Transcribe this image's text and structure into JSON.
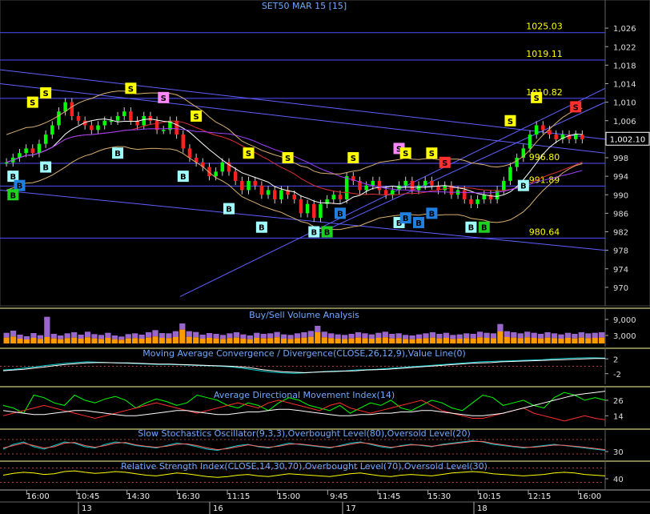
{
  "chart_data": [
    {
      "type": "candlestick",
      "title": "SET50 MAR 15   [15]",
      "ylim": [
        966,
        1030
      ],
      "y_ticks": [
        "1,026",
        "1,022",
        "1,018",
        "1,014",
        "1,010",
        "1,006",
        "1,002",
        "998",
        "994",
        "990",
        "986",
        "982",
        "978",
        "974",
        "970"
      ],
      "y_tick_values": [
        1026,
        1022,
        1018,
        1014,
        1010,
        1006,
        1002,
        998,
        994,
        990,
        986,
        982,
        978,
        974,
        970
      ],
      "last_price": "1,002.10",
      "last_price_value": 1002.1,
      "price_levels": [
        {
          "label": "1025.03",
          "value": 1025.03
        },
        {
          "label": "1019.11",
          "value": 1019.11
        },
        {
          "label": "1010.82",
          "value": 1010.82
        },
        {
          "label": "996.80",
          "value": 996.8
        },
        {
          "label": "991.89",
          "value": 991.89
        },
        {
          "label": "980.64",
          "value": 980.64
        }
      ],
      "candles_close": [
        997,
        998,
        999,
        1000,
        999,
        1001,
        1003,
        1005,
        1008,
        1010,
        1007,
        1006,
        1005,
        1004,
        1005,
        1006,
        1006,
        1007,
        1008,
        1006,
        1005,
        1007,
        1006,
        1004,
        1004,
        1006,
        1003,
        1000,
        998,
        997,
        996,
        994,
        995,
        997,
        995,
        993,
        991,
        993,
        992,
        990,
        991,
        989,
        991,
        990,
        989,
        986,
        988,
        985,
        988,
        989,
        990,
        989,
        994,
        993,
        991,
        992,
        993,
        991,
        990,
        991,
        992,
        993,
        991,
        992,
        993,
        992,
        991,
        992,
        990,
        991,
        989,
        988,
        989,
        990,
        989,
        991,
        993,
        996,
        998,
        1000,
        1003,
        1005,
        1004,
        1003,
        1002,
        1003,
        1002,
        1003,
        1002
      ],
      "signals": [
        {
          "type": "S",
          "style": "yellow",
          "index": 4,
          "price": 1010
        },
        {
          "type": "S",
          "style": "yellow",
          "index": 6,
          "price": 1012
        },
        {
          "type": "S",
          "style": "yellow",
          "index": 19,
          "price": 1013
        },
        {
          "type": "S",
          "style": "pink",
          "index": 24,
          "price": 1011
        },
        {
          "type": "S",
          "style": "yellow",
          "index": 29,
          "price": 1007
        },
        {
          "type": "S",
          "style": "yellow",
          "index": 37,
          "price": 999
        },
        {
          "type": "S",
          "style": "yellow",
          "index": 43,
          "price": 998
        },
        {
          "type": "S",
          "style": "yellow",
          "index": 53,
          "price": 998
        },
        {
          "type": "S",
          "style": "pink",
          "index": 60,
          "price": 1000
        },
        {
          "type": "S",
          "style": "yellow",
          "index": 61,
          "price": 999
        },
        {
          "type": "S",
          "style": "yellow",
          "index": 65,
          "price": 999
        },
        {
          "type": "S",
          "style": "red",
          "index": 67,
          "price": 997
        },
        {
          "type": "S",
          "style": "yellow",
          "index": 77,
          "price": 1006
        },
        {
          "type": "S",
          "style": "yellow",
          "index": 81,
          "price": 1011
        },
        {
          "type": "S",
          "style": "red",
          "index": 87,
          "price": 1009
        },
        {
          "type": "B",
          "style": "cyan",
          "index": 1,
          "price": 994
        },
        {
          "type": "B",
          "style": "blue",
          "index": 2,
          "price": 992
        },
        {
          "type": "B",
          "style": "green",
          "index": 1,
          "price": 990
        },
        {
          "type": "B",
          "style": "cyan",
          "index": 6,
          "price": 996
        },
        {
          "type": "B",
          "style": "cyan",
          "index": 17,
          "price": 999
        },
        {
          "type": "B",
          "style": "cyan",
          "index": 27,
          "price": 994
        },
        {
          "type": "B",
          "style": "cyan",
          "index": 34,
          "price": 987
        },
        {
          "type": "B",
          "style": "cyan",
          "index": 39,
          "price": 983
        },
        {
          "type": "B",
          "style": "cyan",
          "index": 47,
          "price": 982
        },
        {
          "type": "B",
          "style": "green",
          "index": 49,
          "price": 982
        },
        {
          "type": "B",
          "style": "blue",
          "index": 51,
          "price": 986
        },
        {
          "type": "B",
          "style": "cyan",
          "index": 60,
          "price": 984
        },
        {
          "type": "B",
          "style": "blue",
          "index": 61,
          "price": 985
        },
        {
          "type": "B",
          "style": "blue",
          "index": 63,
          "price": 984
        },
        {
          "type": "B",
          "style": "blue",
          "index": 65,
          "price": 986
        },
        {
          "type": "B",
          "style": "cyan",
          "index": 71,
          "price": 983
        },
        {
          "type": "B",
          "style": "green",
          "index": 73,
          "price": 983
        },
        {
          "type": "B",
          "style": "cyan",
          "index": 79,
          "price": 992
        }
      ],
      "colors": {
        "up": "#00ff00",
        "down": "#ff2020",
        "background": "#000000",
        "grid": "#4040ff",
        "level_text": "#ffff00"
      }
    },
    {
      "type": "bar",
      "title": "Buy/Sell Volume Analysis",
      "y_ticks": [
        "9,000",
        "3,000"
      ],
      "y_tick_values": [
        9000,
        3000
      ],
      "ylim": [
        0,
        12000
      ],
      "buy_values": [
        2200,
        2600,
        1800,
        1500,
        2100,
        1700,
        2400,
        1900,
        1600,
        2000,
        2200,
        1800,
        2300,
        1900,
        1700,
        2100,
        1600,
        1400,
        1900,
        2000,
        1800,
        2200,
        2600,
        2100,
        2000,
        2400,
        5200,
        2500,
        2300,
        1800,
        2100,
        1900,
        1700,
        2000,
        2200,
        1800,
        1600,
        2100,
        1900,
        2000,
        2300,
        1800,
        1700,
        2000,
        2200,
        2500,
        4200,
        2300,
        2000,
        1800,
        1700,
        1900,
        2200,
        2000,
        1800,
        2100,
        2300,
        1900,
        2000,
        1700,
        1600,
        1800,
        2000,
        2200,
        1900,
        2100,
        1700,
        1800,
        2000,
        1900,
        2300,
        2100,
        2000,
        4500,
        2400,
        2200,
        2000,
        2300,
        2100,
        1900,
        2200,
        2000,
        1800,
        2100,
        1900,
        2200,
        2000,
        2100,
        2200
      ],
      "sell_values": [
        1800,
        2200,
        1500,
        1200,
        1800,
        1400,
        7600,
        1700,
        1400,
        1800,
        2000,
        1500,
        2100,
        1600,
        1500,
        1900,
        1400,
        1200,
        1600,
        1800,
        1500,
        2000,
        2400,
        1800,
        1800,
        2200,
        2300,
        2100,
        2000,
        1500,
        1800,
        1700,
        1500,
        1800,
        2000,
        1600,
        1400,
        1900,
        1700,
        1800,
        2000,
        1600,
        1500,
        1800,
        2000,
        2200,
        2400,
        2100,
        1800,
        1600,
        1500,
        1700,
        2000,
        1800,
        1600,
        1900,
        2100,
        1700,
        1800,
        1500,
        1400,
        1600,
        1800,
        2000,
        1700,
        1900,
        1500,
        1600,
        1800,
        1700,
        2100,
        1900,
        1800,
        2800,
        2200,
        2000,
        1800,
        2100,
        1900,
        1700,
        2000,
        1800,
        1600,
        1900,
        1700,
        2000,
        1800,
        1900,
        2000
      ],
      "colors": {
        "buy": "#ff9900",
        "sell": "#9966cc"
      }
    },
    {
      "type": "line",
      "title": "Moving Average Convergence / Divergence(CLOSE,26,12,9),Value Line(0)",
      "y_ticks": [
        "2",
        "-2"
      ],
      "y_tick_values": [
        2,
        -2
      ],
      "ylim": [
        -4,
        4
      ],
      "series": [
        {
          "values": [
            -1,
            -0.8,
            -0.5,
            -0.2,
            0.2,
            0.5,
            0.8,
            1,
            1.2,
            1.1,
            1,
            0.9,
            0.8,
            0.7,
            0.6,
            0.5,
            0.5,
            0.4,
            0.3,
            0.2,
            0.1,
            0,
            -0.2,
            -0.5,
            -0.9,
            -1.3,
            -1.6,
            -1.8,
            -1.9,
            -1.8,
            -1.6,
            -1.4,
            -1.3,
            -1.2,
            -1.0,
            -0.9,
            -0.8,
            -0.6,
            -0.4,
            -0.2,
            0,
            0.2,
            0.4,
            0.6,
            0.8,
            1,
            1.2,
            1.3,
            1.4,
            1.5,
            1.6,
            1.7,
            1.8,
            2,
            2.1,
            2.2,
            2.3,
            2.3,
            2.2
          ],
          "color": "#00cccc"
        },
        {
          "values": [
            -1.2,
            -1,
            -0.8,
            -0.5,
            -0.2,
            0.2,
            0.5,
            0.7,
            0.9,
            1,
            1,
            0.9,
            0.9,
            0.8,
            0.7,
            0.6,
            0.6,
            0.5,
            0.4,
            0.3,
            0.2,
            0.1,
            0,
            -0.2,
            -0.5,
            -0.9,
            -1.2,
            -1.5,
            -1.6,
            -1.7,
            -1.6,
            -1.5,
            -1.4,
            -1.3,
            -1.2,
            -1.0,
            -0.9,
            -0.8,
            -0.6,
            -0.4,
            -0.2,
            0,
            0.2,
            0.4,
            0.6,
            0.8,
            0.9,
            1.0,
            1.2,
            1.3,
            1.4,
            1.5,
            1.6,
            1.7,
            1.8,
            1.9,
            2,
            2.1,
            2.1
          ],
          "color": "#ffffff"
        }
      ]
    },
    {
      "type": "line",
      "title": "Average Directional Movement Index(14)",
      "y_ticks": [
        "26",
        "14"
      ],
      "y_tick_values": [
        26,
        14
      ],
      "ylim": [
        8,
        34
      ],
      "series": [
        {
          "values": [
            22,
            20,
            16,
            30,
            28,
            24,
            22,
            30,
            26,
            24,
            27,
            29,
            26,
            20,
            24,
            27,
            25,
            22,
            24,
            30,
            28,
            26,
            22,
            20,
            24,
            22,
            18,
            24,
            28,
            26,
            22,
            20,
            18,
            22,
            16,
            20,
            24,
            22,
            26,
            20,
            18,
            22,
            26,
            24,
            20,
            18,
            24,
            30,
            28,
            22,
            24,
            26,
            22,
            20,
            28,
            32,
            30,
            26,
            28,
            26
          ],
          "color": "#00ff00"
        },
        {
          "values": [
            14,
            16,
            18,
            20,
            22,
            20,
            18,
            16,
            14,
            12,
            14,
            16,
            18,
            20,
            22,
            24,
            22,
            20,
            18,
            16,
            18,
            20,
            22,
            24,
            22,
            20,
            24,
            26,
            24,
            22,
            20,
            18,
            22,
            24,
            20,
            18,
            16,
            18,
            20,
            22,
            24,
            26,
            22,
            18,
            16,
            14,
            12,
            12,
            14,
            16,
            18,
            20,
            16,
            14,
            12,
            10,
            12,
            14,
            12,
            11
          ],
          "color": "#ff3030"
        },
        {
          "values": [
            18,
            17,
            16,
            15,
            15,
            16,
            17,
            18,
            18,
            17,
            16,
            15,
            14,
            14,
            15,
            16,
            17,
            18,
            18,
            17,
            16,
            15,
            15,
            16,
            17,
            17,
            18,
            19,
            19,
            18,
            17,
            16,
            15,
            14,
            14,
            15,
            15,
            16,
            16,
            17,
            17,
            18,
            18,
            17,
            16,
            15,
            14,
            14,
            15,
            16,
            18,
            20,
            22,
            24,
            26,
            28,
            30,
            31,
            32,
            33
          ],
          "color": "#ffffff"
        }
      ]
    },
    {
      "type": "line",
      "title": "Slow Stochastics Oscillator(9,3,3),Overbought Level(80),Oversold Level(20)",
      "y_ticks": [
        "30"
      ],
      "y_tick_values": [
        30
      ],
      "ylim": [
        10,
        110
      ],
      "series": [
        {
          "values": [
            40,
            60,
            70,
            50,
            40,
            55,
            70,
            65,
            50,
            45,
            60,
            70,
            65,
            55,
            50,
            45,
            55,
            65,
            60,
            50,
            40,
            35,
            45,
            55,
            60,
            50,
            45,
            55,
            65,
            60,
            55,
            50,
            45,
            55,
            65,
            70,
            60,
            50,
            45,
            55,
            60,
            55,
            50,
            60,
            65,
            70,
            75,
            70,
            60,
            55,
            50,
            45,
            50,
            55,
            60,
            55,
            50,
            45,
            40,
            35
          ],
          "color": "#00cccc"
        },
        {
          "values": [
            45,
            55,
            65,
            55,
            45,
            50,
            65,
            68,
            55,
            48,
            55,
            65,
            68,
            58,
            52,
            48,
            52,
            60,
            62,
            55,
            45,
            38,
            42,
            50,
            58,
            52,
            48,
            52,
            60,
            62,
            57,
            52,
            48,
            52,
            60,
            67,
            63,
            54,
            48,
            52,
            58,
            57,
            52,
            57,
            62,
            67,
            72,
            72,
            64,
            58,
            52,
            48,
            48,
            52,
            57,
            56,
            52,
            48,
            43,
            38
          ],
          "color": "#ff6060"
        }
      ]
    },
    {
      "type": "line",
      "title": "Relative Strength Index(CLOSE,14,30,70),Overbought Level(70),Oversold Level(30)",
      "y_ticks": [
        "40"
      ],
      "y_tick_values": [
        40
      ],
      "ylim": [
        20,
        80
      ],
      "series": [
        {
          "values": [
            50,
            55,
            58,
            56,
            52,
            54,
            60,
            62,
            58,
            55,
            57,
            60,
            58,
            54,
            50,
            48,
            52,
            56,
            54,
            50,
            46,
            44,
            46,
            50,
            52,
            48,
            46,
            50,
            54,
            52,
            50,
            48,
            46,
            50,
            54,
            56,
            52,
            48,
            46,
            50,
            52,
            50,
            48,
            52,
            56,
            58,
            60,
            58,
            54,
            52,
            50,
            48,
            50,
            52,
            56,
            58,
            56,
            52,
            50,
            48
          ],
          "color": "#ffff00"
        }
      ]
    },
    {
      "type": "time_axis",
      "time_labels": [
        "16:00",
        "10:45",
        "14:30",
        "16:30",
        "11:15",
        "15:00",
        "9:45",
        "11:45",
        "15:30",
        "10:15",
        "12:15",
        "16:00"
      ],
      "date_labels": [
        "13",
        "16",
        "17",
        "18"
      ],
      "time_tick_index": [
        4,
        12,
        20,
        28,
        36,
        44,
        52,
        60,
        68,
        76,
        84,
        92
      ],
      "date_tick_index": [
        5,
        14,
        23,
        32
      ]
    }
  ]
}
